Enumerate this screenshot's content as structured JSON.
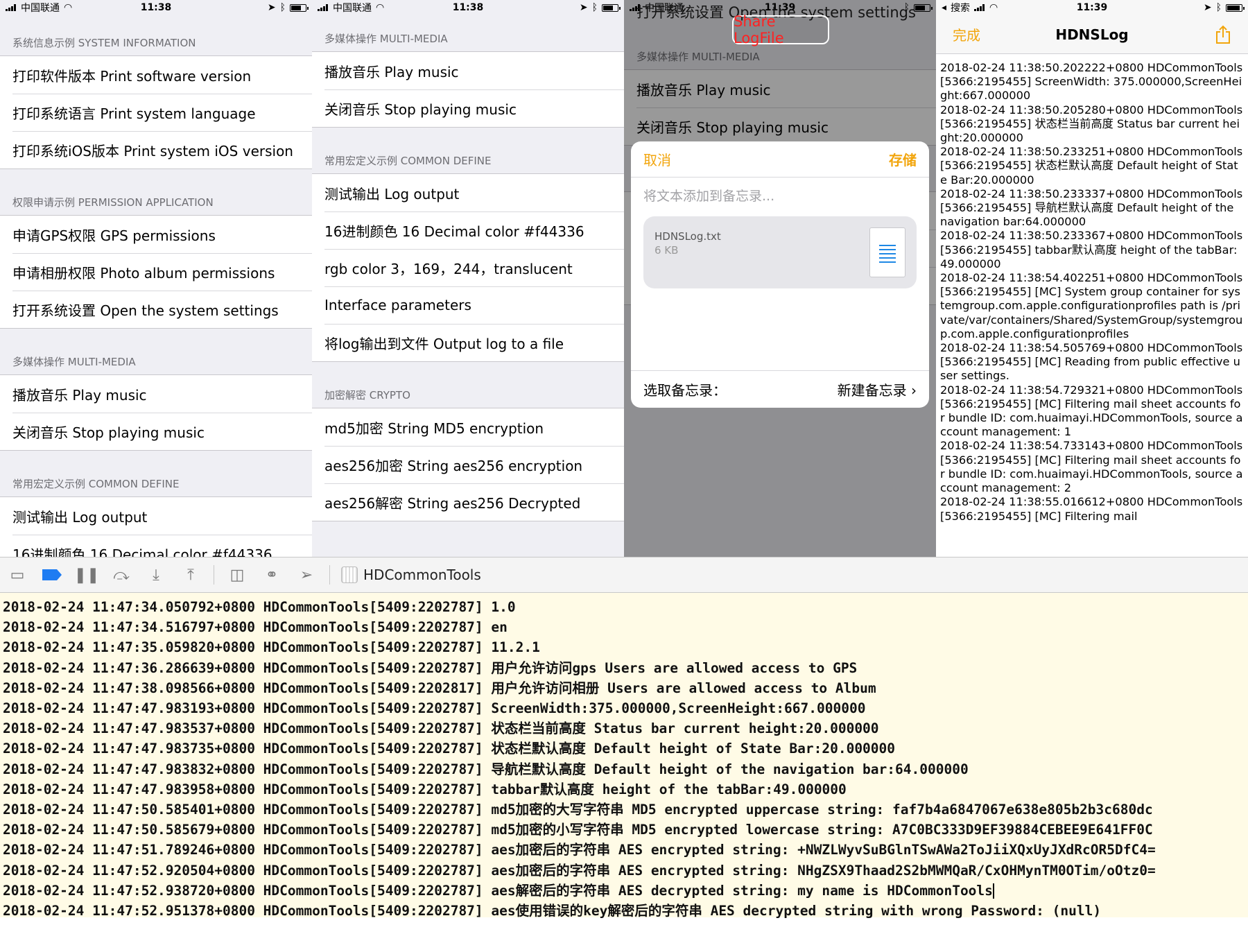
{
  "phone1": {
    "status": {
      "carrier": "中国联通",
      "time": "11:38"
    },
    "sections": [
      {
        "header": "系统信息示例 SYSTEM INFORMATION",
        "items": [
          "打印软件版本 Print software version",
          "打印系统语言 Print system language",
          "打印系统iOS版本 Print system iOS version"
        ]
      },
      {
        "header": "权限申请示例 PERMISSION APPLICATION",
        "items": [
          "申请GPS权限 GPS permissions",
          "申请相册权限 Photo album permissions",
          "打开系统设置 Open the system settings"
        ]
      },
      {
        "header": "多媒体操作 MULTI-MEDIA",
        "items": [
          "播放音乐 Play music",
          "关闭音乐 Stop playing music"
        ]
      },
      {
        "header": "常用宏定义示例 COMMON DEFINE",
        "items": [
          "测试输出 Log output",
          "16进制颜色 16 Decimal color #f44336"
        ]
      }
    ]
  },
  "phone2": {
    "status": {
      "carrier": "中国联通",
      "time": "11:38"
    },
    "sections": [
      {
        "header": "多媒体操作 MULTI-MEDIA",
        "items": [
          "播放音乐 Play music",
          "关闭音乐 Stop playing music"
        ]
      },
      {
        "header": "常用宏定义示例 COMMON DEFINE",
        "items": [
          "测试输出 Log output",
          "16进制颜色 16 Decimal color #f44336",
          "rgb color 3，169，244，translucent",
          "Interface parameters",
          "将log输出到文件 Output log to a file"
        ]
      },
      {
        "header": "加密解密 CRYPTO",
        "items": [
          "md5加密 String MD5 encryption",
          "aes256加密 String aes256 encryption",
          "aes256解密 String aes256 Decrypted"
        ]
      }
    ]
  },
  "phone3": {
    "status": {
      "carrier": "中国联通",
      "time": "11:39"
    },
    "ghost_title": "打开系统设置 Open the system settings",
    "share_button": "Share LogFile",
    "sections": [
      {
        "header": "多媒体操作 MULTI-MEDIA",
        "items": [
          "播放音乐 Play music",
          "关闭音乐 Stop playing music"
        ]
      },
      {
        "header": "加密解密 CRYPTO",
        "items": [
          "md5加密 String MD5 encryption",
          "aes256加密 String aes256 encryption",
          "aes256解密 String aes256 Decrypted"
        ]
      }
    ],
    "sheet": {
      "cancel": "取消",
      "save": "存储",
      "placeholder": "将文本添加到备忘录...",
      "file_name": "HDNSLog.txt",
      "file_size": "6 KB",
      "choose_label": "选取备忘录：",
      "new_note": "新建备忘录"
    }
  },
  "phone4": {
    "status": {
      "back": "搜索",
      "time": "11:39"
    },
    "nav": {
      "done": "完成",
      "title": "HDNSLog"
    },
    "log": "2018-02-24 11:38:50.202222+0800 HDCommonTools[5366:2195455] ScreenWidth: 375.000000,ScreenHeight:667.000000\n2018-02-24 11:38:50.205280+0800 HDCommonTools[5366:2195455] 状态栏当前高度 Status bar current height:20.000000\n2018-02-24 11:38:50.233251+0800 HDCommonTools[5366:2195455] 状态栏默认高度 Default height of State Bar:20.000000\n2018-02-24 11:38:50.233337+0800 HDCommonTools[5366:2195455] 导航栏默认高度 Default height of the navigation bar:64.000000\n2018-02-24 11:38:50.233367+0800 HDCommonTools[5366:2195455] tabbar默认高度 height of the tabBar:49.000000\n2018-02-24 11:38:54.402251+0800 HDCommonTools[5366:2195455] [MC] System group container for systemgroup.com.apple.configurationprofiles path is /private/var/containers/Shared/SystemGroup/systemgroup.com.apple.configurationprofiles\n2018-02-24 11:38:54.505769+0800 HDCommonTools[5366:2195455] [MC] Reading from public effective user settings.\n2018-02-24 11:38:54.729321+0800 HDCommonTools[5366:2195455] [MC] Filtering mail sheet accounts for bundle ID: com.huaimayi.HDCommonTools, source account management: 1\n2018-02-24 11:38:54.733143+0800 HDCommonTools[5366:2195455] [MC] Filtering mail sheet accounts for bundle ID: com.huaimayi.HDCommonTools, source account management: 2\n2018-02-24 11:38:55.016612+0800 HDCommonTools[5366:2195455] [MC] Filtering mail"
  },
  "xcode": {
    "target": "HDCommonTools",
    "console_lines": [
      "2018-02-24 11:47:34.050792+0800 HDCommonTools[5409:2202787] 1.0",
      "2018-02-24 11:47:34.516797+0800 HDCommonTools[5409:2202787] en",
      "2018-02-24 11:47:35.059820+0800 HDCommonTools[5409:2202787] 11.2.1",
      "2018-02-24 11:47:36.286639+0800 HDCommonTools[5409:2202787] 用户允许访问gps Users are allowed access to GPS",
      "2018-02-24 11:47:38.098566+0800 HDCommonTools[5409:2202817] 用户允许访问相册 Users are allowed access to Album",
      "2018-02-24 11:47:47.983193+0800 HDCommonTools[5409:2202787] ScreenWidth:375.000000,ScreenHeight:667.000000",
      "2018-02-24 11:47:47.983537+0800 HDCommonTools[5409:2202787] 状态栏当前高度 Status bar current height:20.000000",
      "2018-02-24 11:47:47.983735+0800 HDCommonTools[5409:2202787] 状态栏默认高度 Default height of State Bar:20.000000",
      "2018-02-24 11:47:47.983832+0800 HDCommonTools[5409:2202787] 导航栏默认高度 Default height of the navigation bar:64.000000",
      "2018-02-24 11:47:47.983958+0800 HDCommonTools[5409:2202787] tabbar默认高度 height of the tabBar:49.000000",
      "2018-02-24 11:47:50.585401+0800 HDCommonTools[5409:2202787] md5加密的大写字符串 MD5 encrypted uppercase string: faf7b4a6847067e638e805b2b3c680dc",
      "2018-02-24 11:47:50.585679+0800 HDCommonTools[5409:2202787] md5加密的小写字符串 MD5 encrypted lowercase string: A7C0BC333D9EF39884CEBEE9E641FF0C",
      "2018-02-24 11:47:51.789246+0800 HDCommonTools[5409:2202787] aes加密后的字符串 AES encrypted string: +NWZLWyvSuBGlnTSwAWa2ToJiiXQxUyJXdRcOR5DfC4=",
      "2018-02-24 11:47:52.920504+0800 HDCommonTools[5409:2202787] aes加密后的字符串 AES encrypted string: NHgZSX9Thaad2S2bMWMQaR/CxOHMynTM0OTim/oOtz0=",
      "2018-02-24 11:47:52.938720+0800 HDCommonTools[5409:2202787] aes解密后的字符串 AES decrypted string: my name is HDCommonTools",
      "2018-02-24 11:47:52.951378+0800 HDCommonTools[5409:2202787] aes使用错误的key解密后的字符串 AES decrypted string with wrong Password: (null)"
    ]
  },
  "colors": {
    "accent_orange": "#f2a50c",
    "share_red": "#ff2222",
    "console_bg": "#fffbe6",
    "breakpoint_blue": "#1e7cf2"
  }
}
